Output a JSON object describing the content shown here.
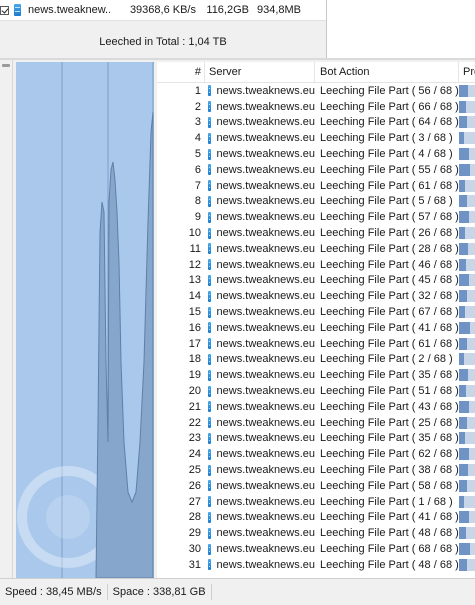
{
  "server_row": {
    "name": "news.tweaknew...",
    "speed": "39368,6 KB/s",
    "total": "116,2GB",
    "today": "934,8MB"
  },
  "leeched_total": "Leeched in Total : 1,04 TB",
  "table": {
    "columns": {
      "num": "#",
      "server": "Server",
      "action": "Bot Action",
      "progress": "Pro"
    },
    "rows": [
      {
        "num": "1",
        "server": "news.tweaknews.eu",
        "action": "Leeching File Part ( 56 / 68 )"
      },
      {
        "num": "2",
        "server": "news.tweaknews.eu",
        "action": "Leeching File Part ( 66 / 68 )"
      },
      {
        "num": "3",
        "server": "news.tweaknews.eu",
        "action": "Leeching File Part ( 64 / 68 )"
      },
      {
        "num": "4",
        "server": "news.tweaknews.eu",
        "action": "Leeching File Part ( 3 / 68 )"
      },
      {
        "num": "5",
        "server": "news.tweaknews.eu",
        "action": "Leeching File Part ( 4 / 68 )"
      },
      {
        "num": "6",
        "server": "news.tweaknews.eu",
        "action": "Leeching File Part ( 55 / 68 )"
      },
      {
        "num": "7",
        "server": "news.tweaknews.eu",
        "action": "Leeching File Part ( 61 / 68 )"
      },
      {
        "num": "8",
        "server": "news.tweaknews.eu",
        "action": "Leeching File Part ( 5 / 68 )"
      },
      {
        "num": "9",
        "server": "news.tweaknews.eu",
        "action": "Leeching File Part ( 57 / 68 )"
      },
      {
        "num": "10",
        "server": "news.tweaknews.eu",
        "action": "Leeching File Part ( 26 / 68 )"
      },
      {
        "num": "11",
        "server": "news.tweaknews.eu",
        "action": "Leeching File Part ( 28 / 68 )"
      },
      {
        "num": "12",
        "server": "news.tweaknews.eu",
        "action": "Leeching File Part ( 46 / 68 )"
      },
      {
        "num": "13",
        "server": "news.tweaknews.eu",
        "action": "Leeching File Part ( 45 / 68 )"
      },
      {
        "num": "14",
        "server": "news.tweaknews.eu",
        "action": "Leeching File Part ( 32 / 68 )"
      },
      {
        "num": "15",
        "server": "news.tweaknews.eu",
        "action": "Leeching File Part ( 67 / 68 )"
      },
      {
        "num": "16",
        "server": "news.tweaknews.eu",
        "action": "Leeching File Part ( 41 / 68 )"
      },
      {
        "num": "17",
        "server": "news.tweaknews.eu",
        "action": "Leeching File Part ( 61 / 68 )"
      },
      {
        "num": "18",
        "server": "news.tweaknews.eu",
        "action": "Leeching File Part ( 2 / 68 )"
      },
      {
        "num": "19",
        "server": "news.tweaknews.eu",
        "action": "Leeching File Part ( 35 / 68 )"
      },
      {
        "num": "20",
        "server": "news.tweaknews.eu",
        "action": "Leeching File Part ( 51 / 68 )"
      },
      {
        "num": "21",
        "server": "news.tweaknews.eu",
        "action": "Leeching File Part ( 43 / 68 )"
      },
      {
        "num": "22",
        "server": "news.tweaknews.eu",
        "action": "Leeching File Part ( 25 / 68 )"
      },
      {
        "num": "23",
        "server": "news.tweaknews.eu",
        "action": "Leeching File Part ( 35 / 68 )"
      },
      {
        "num": "24",
        "server": "news.tweaknews.eu",
        "action": "Leeching File Part ( 62 / 68 )"
      },
      {
        "num": "25",
        "server": "news.tweaknews.eu",
        "action": "Leeching File Part ( 38 / 68 )"
      },
      {
        "num": "26",
        "server": "news.tweaknews.eu",
        "action": "Leeching File Part ( 58 / 68 )"
      },
      {
        "num": "27",
        "server": "news.tweaknews.eu",
        "action": "Leeching File Part ( 1 / 68 )"
      },
      {
        "num": "28",
        "server": "news.tweaknews.eu",
        "action": "Leeching File Part ( 41 / 68 )"
      },
      {
        "num": "29",
        "server": "news.tweaknews.eu",
        "action": "Leeching File Part ( 48 / 68 )"
      },
      {
        "num": "30",
        "server": "news.tweaknews.eu",
        "action": "Leeching File Part ( 68 / 68 )"
      },
      {
        "num": "31",
        "server": "news.tweaknews.eu",
        "action": "Leeching File Part ( 48 / 68 )"
      }
    ]
  },
  "progress_fractions": [
    0.55,
    0.45,
    0.5,
    0.3,
    0.6,
    0.7,
    0.4,
    0.5,
    0.65,
    0.35,
    0.55,
    0.45,
    0.6,
    0.5,
    0.4,
    0.7,
    0.5,
    0.3,
    0.55,
    0.45,
    0.6,
    0.5,
    0.4,
    0.65,
    0.55,
    0.5,
    0.3,
    0.6,
    0.45,
    0.7,
    0.5
  ],
  "status": {
    "speed": "Speed : 38,45 MB/s",
    "space": "Space : 338,81 GB"
  },
  "colors": {
    "graph_bg": "#a9c8eb",
    "graph_fill": "#86a6cc",
    "graph_line": "#5f7fa8",
    "server_icon": "#1a7bd0",
    "progress_fill": "#6f93c4"
  },
  "icons": {
    "server": "server-file-icon",
    "checkbox": "checkbox-checked-icon",
    "watermark": "app-watermark-icon"
  }
}
